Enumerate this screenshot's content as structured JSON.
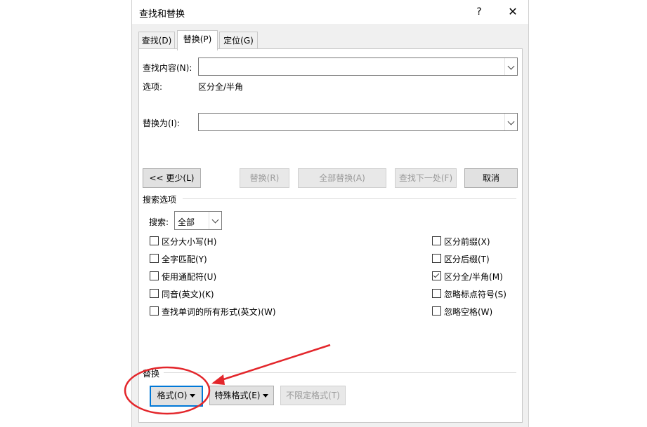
{
  "dialog": {
    "title": "查找和替换",
    "help": "?",
    "close": "✕"
  },
  "tabs": [
    "查找(D)",
    "替换(P)",
    "定位(G)"
  ],
  "find": {
    "label": "查找内容(N):",
    "value": ""
  },
  "options": {
    "label": "选项:",
    "value": "区分全/半角"
  },
  "replace": {
    "label": "替换为(I):",
    "value": ""
  },
  "buttons": {
    "less": "<< 更少(L)",
    "replace": "替换(R)",
    "replace_all": "全部替换(A)",
    "find_next": "查找下一处(F)",
    "cancel": "取消"
  },
  "search_options": {
    "group_label": "搜索选项",
    "search_label": "搜索:",
    "search_value": "全部",
    "left": [
      {
        "label": "区分大小写(H)",
        "checked": false
      },
      {
        "label": "全字匹配(Y)",
        "checked": false
      },
      {
        "label": "使用通配符(U)",
        "checked": false
      },
      {
        "label": "同音(英文)(K)",
        "checked": false
      },
      {
        "label": "查找单词的所有形式(英文)(W)",
        "checked": false
      }
    ],
    "right": [
      {
        "label": "区分前缀(X)",
        "checked": false
      },
      {
        "label": "区分后缀(T)",
        "checked": false
      },
      {
        "label": "区分全/半角(M)",
        "checked": true
      },
      {
        "label": "忽略标点符号(S)",
        "checked": false
      },
      {
        "label": "忽略空格(W)",
        "checked": false
      }
    ]
  },
  "replace_group": {
    "label": "替换",
    "format": "格式(O)",
    "special": "特殊格式(E)",
    "no_format": "不限定格式(T)"
  },
  "annotation_color": "#e3262b"
}
